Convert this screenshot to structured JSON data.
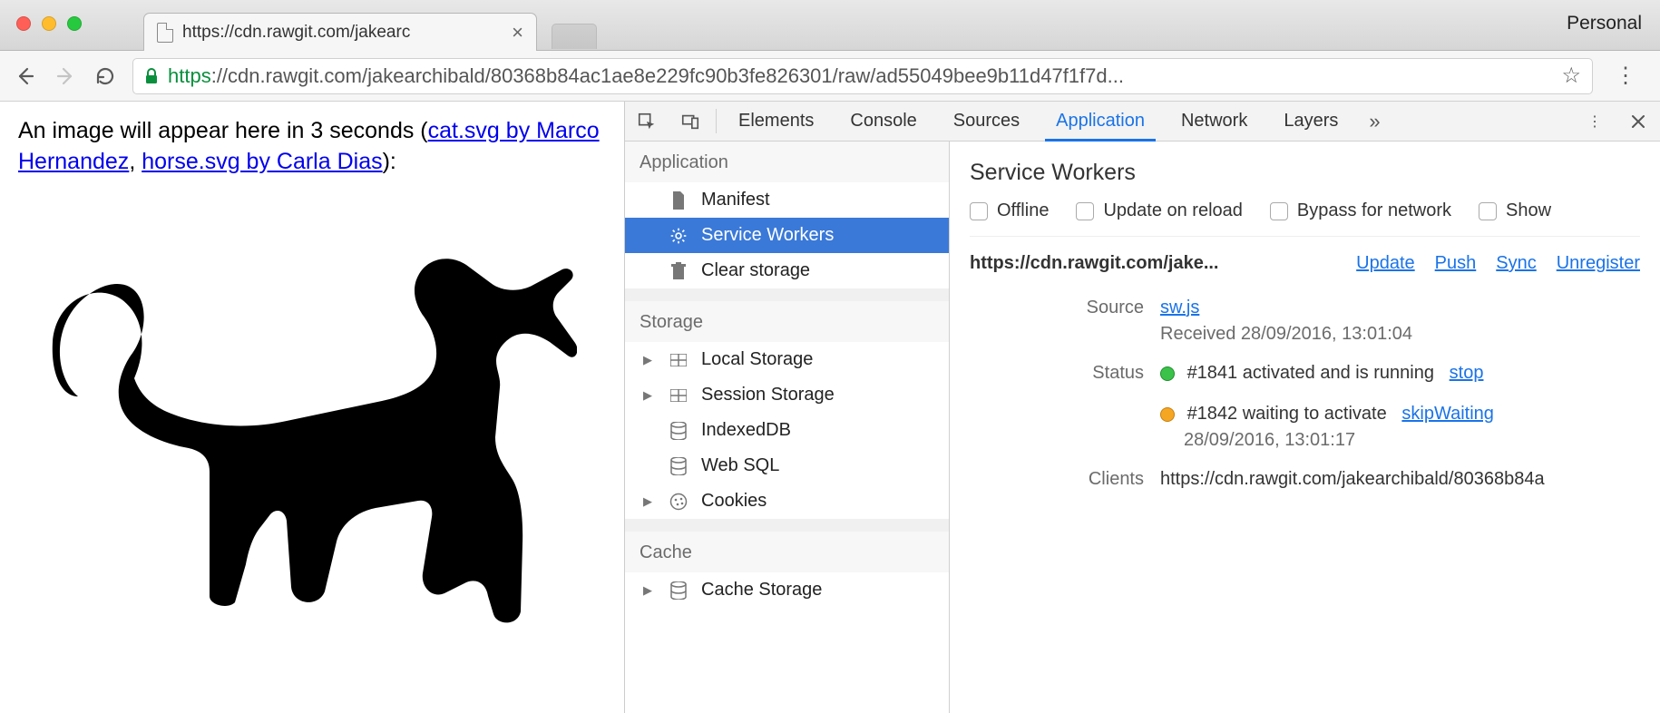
{
  "window": {
    "personal_label": "Personal"
  },
  "tab": {
    "title": "https://cdn.rawgit.com/jakearc"
  },
  "omnibox": {
    "secure": "https",
    "rest": "://cdn.rawgit.com/jakearchibald/80368b84ac1ae8e229fc90b3fe826301/raw/ad55049bee9b11d47f1f7d..."
  },
  "page": {
    "prefix": "An image will appear here in 3 seconds (",
    "link1": "cat.svg by Marco Hernandez",
    "sep": ", ",
    "link2": "horse.svg by Carla Dias",
    "suffix": "):"
  },
  "devtools": {
    "tabs": [
      "Elements",
      "Console",
      "Sources",
      "Application",
      "Network",
      "Layers"
    ],
    "active_tab": "Application",
    "overflow": "»",
    "sidebar": {
      "groups": [
        {
          "title": "Application",
          "items": [
            {
              "key": "manifest",
              "label": "Manifest",
              "icon": "doc"
            },
            {
              "key": "service-workers",
              "label": "Service Workers",
              "icon": "gear",
              "selected": true
            },
            {
              "key": "clear-storage",
              "label": "Clear storage",
              "icon": "trash"
            }
          ]
        },
        {
          "title": "Storage",
          "items": [
            {
              "key": "local-storage",
              "label": "Local Storage",
              "icon": "grid",
              "caret": true
            },
            {
              "key": "session-storage",
              "label": "Session Storage",
              "icon": "grid",
              "caret": true
            },
            {
              "key": "indexeddb",
              "label": "IndexedDB",
              "icon": "db"
            },
            {
              "key": "web-sql",
              "label": "Web SQL",
              "icon": "db"
            },
            {
              "key": "cookies",
              "label": "Cookies",
              "icon": "cookie",
              "caret": true
            }
          ]
        },
        {
          "title": "Cache",
          "items": [
            {
              "key": "cache-storage",
              "label": "Cache Storage",
              "icon": "db",
              "caret": true
            }
          ]
        }
      ]
    },
    "sw": {
      "heading": "Service Workers",
      "opts": [
        "Offline",
        "Update on reload",
        "Bypass for network",
        "Show"
      ],
      "scope": "https://cdn.rawgit.com/jake...",
      "actions": [
        "Update",
        "Push",
        "Sync",
        "Unregister"
      ],
      "source_label": "Source",
      "source_link": "sw.js",
      "source_received": "Received 28/09/2016, 13:01:04",
      "status_label": "Status",
      "status1_text": "#1841 activated and is running",
      "status1_action": "stop",
      "status2_text": "#1842 waiting to activate",
      "status2_action": "skipWaiting",
      "status2_time": "28/09/2016, 13:01:17",
      "clients_label": "Clients",
      "clients_value": "https://cdn.rawgit.com/jakearchibald/80368b84a"
    }
  }
}
